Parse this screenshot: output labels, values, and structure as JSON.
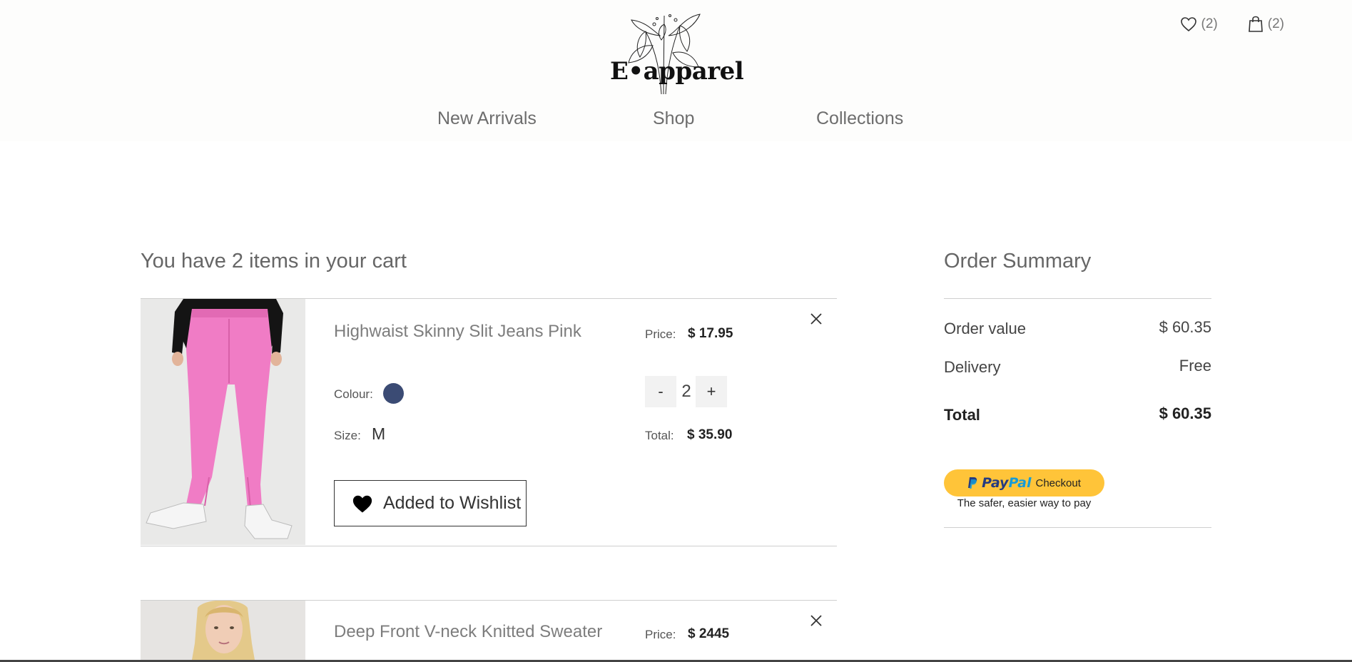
{
  "header": {
    "brand": "E•apparel",
    "wishlist_count": "(2)",
    "cart_count": "(2)",
    "nav": [
      "New Arrivals",
      "Shop",
      "Collections"
    ]
  },
  "cart": {
    "title": "You have 2 items in your cart",
    "items": [
      {
        "name": "Highwaist Skinny Slit Jeans Pink",
        "price_label": "Price:",
        "price": "$ 17.95",
        "colour_label": "Colour:",
        "colour": "#3b4b74",
        "size_label": "Size:",
        "size": "M",
        "qty_minus": "-",
        "quantity": "2",
        "qty_plus": "+",
        "total_label": "Total:",
        "total": "$ 35.90",
        "wishlist_label": "Added to Wishlist"
      },
      {
        "name": "Deep Front V-neck Knitted Sweater",
        "price_label": "Price:",
        "price": "$ 2445"
      }
    ]
  },
  "summary": {
    "title": "Order Summary",
    "order_value_label": "Order value",
    "order_value": "$ 60.35",
    "delivery_label": "Delivery",
    "delivery": "Free",
    "total_label": "Total",
    "total": "$ 60.35",
    "paypal_pay": "Pay",
    "paypal_pal": "Pal",
    "paypal_checkout": "Checkout",
    "paypal_tagline": "The safer, easier way to pay"
  }
}
